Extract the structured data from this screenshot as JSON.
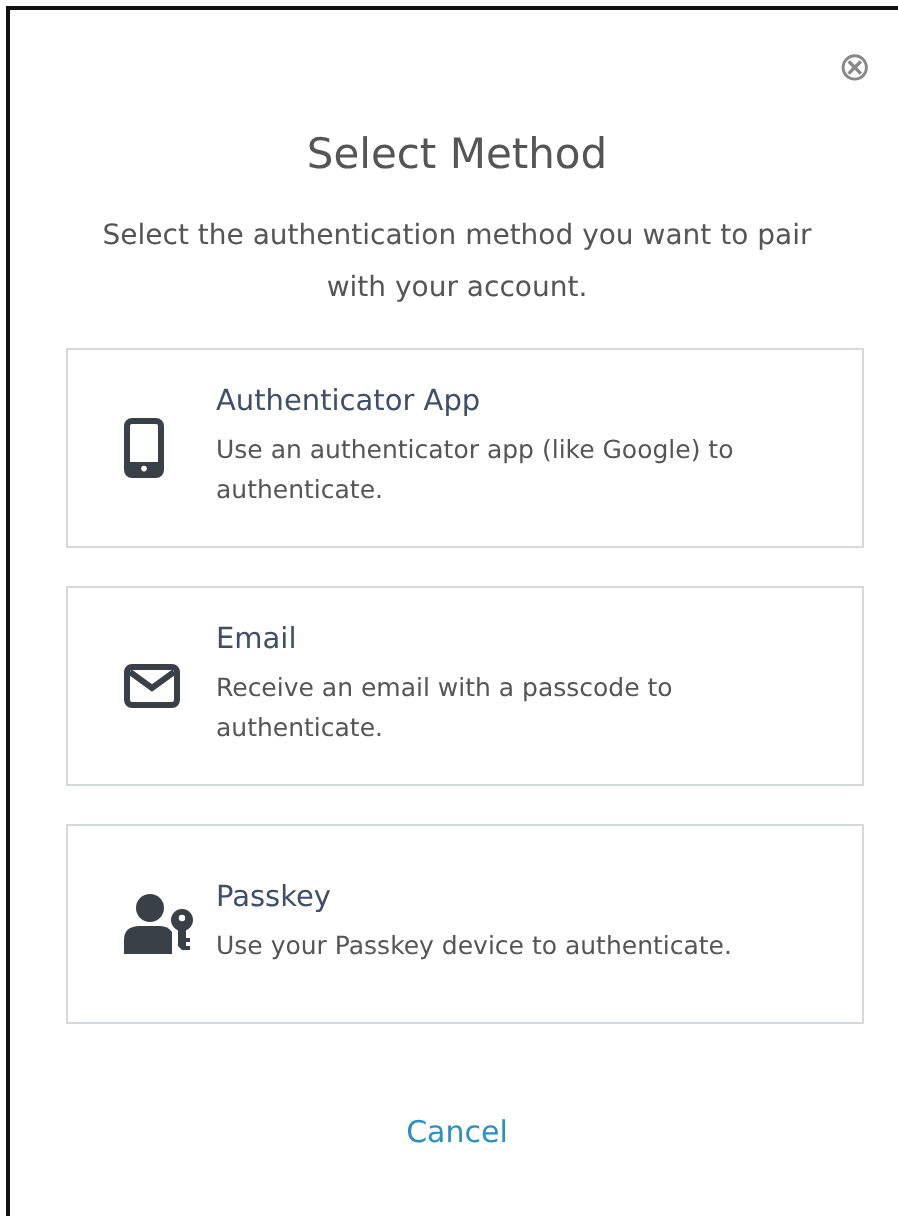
{
  "dialog": {
    "close": "⊗",
    "title": "Select Method",
    "subtitle": "Select the authentication method you want to pair with your account."
  },
  "methods": [
    {
      "kind": "phone",
      "title": "Authenticator App",
      "description": "Use an authenticator app (like Google) to authenticate."
    },
    {
      "kind": "mail",
      "title": "Email",
      "description": "Receive an email with a passcode to authenticate."
    },
    {
      "kind": "passkey",
      "title": "Passkey",
      "description": "Use your Passkey device to authenticate."
    }
  ],
  "cancel": "Cancel"
}
